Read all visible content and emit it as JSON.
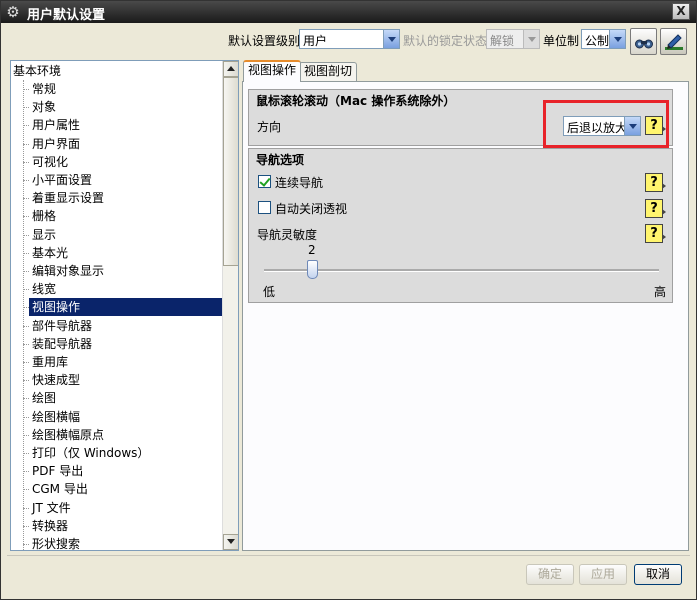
{
  "window": {
    "title": "用户默认设置",
    "close_glyph": "X"
  },
  "toolbar": {
    "level_label": "默认设置级别",
    "level_value": "用户",
    "lock_label": "默认的锁定状态",
    "lock_value": "解锁",
    "unit_label": "单位制",
    "unit_value": "公制"
  },
  "tree": {
    "root": "基本环境",
    "items": [
      "常规",
      "对象",
      "用户属性",
      "用户界面",
      "可视化",
      "小平面设置",
      "着重显示设置",
      "栅格",
      "显示",
      "基本光",
      "编辑对象显示",
      "线宽",
      "视图操作",
      "部件导航器",
      "装配导航器",
      "重用库",
      "快速成型",
      "绘图",
      "绘图横幅",
      "绘图横幅原点",
      "打印（仅 Windows）",
      "PDF 导出",
      "CGM 导出",
      "JT 文件",
      "转换器",
      "形状搜索"
    ],
    "selected_index": 12
  },
  "tabs": [
    {
      "label": "视图操作",
      "active": true
    },
    {
      "label": "视图剖切",
      "active": false
    }
  ],
  "scroll_group": {
    "title": "鼠标滚轮滚动（Mac 操作系统除外）",
    "direction_label": "方向",
    "direction_value": "后退以放大"
  },
  "nav_group": {
    "title": "导航选项",
    "continuous_nav_label": "连续导航",
    "continuous_nav_checked": true,
    "auto_close_persp_label": "自动关闭透视",
    "auto_close_persp_checked": false,
    "sensitivity_label": "导航灵敏度",
    "sensitivity_value": "2",
    "min_label": "低",
    "max_label": "高"
  },
  "help_glyph": "?",
  "buttons": {
    "ok": "确定",
    "apply": "应用",
    "cancel": "取消"
  },
  "colors": {
    "highlight": "#e8232a",
    "selection": "#0a246a"
  }
}
